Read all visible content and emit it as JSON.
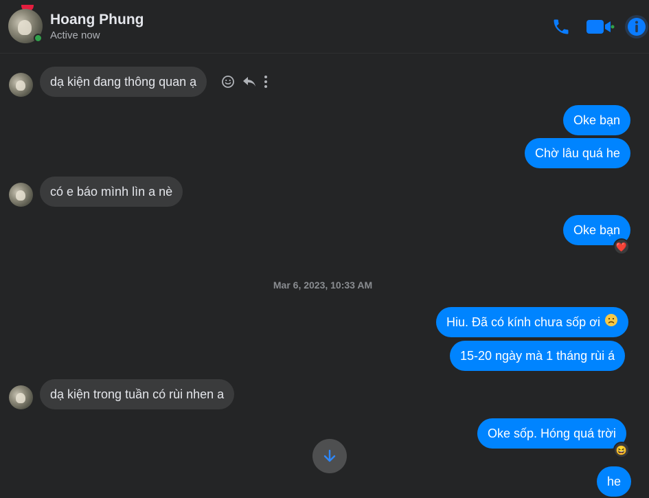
{
  "contact": {
    "name": "Hoang Phung",
    "status": "Active now"
  },
  "header_icons": [
    "call-icon",
    "video-icon",
    "info-icon"
  ],
  "colors": {
    "accent": "#0084ff",
    "icon_blue": "#0a7cff",
    "incoming_bubble": "#3a3b3c",
    "background": "#242526",
    "online": "#31a24c"
  },
  "messages": [
    {
      "direction": "in",
      "text": "dạ kiện đang thông quan ạ"
    },
    {
      "direction": "out",
      "text": "Oke bạn"
    },
    {
      "direction": "out",
      "text": "Chờ lâu quá he"
    },
    {
      "direction": "in",
      "text": "có e báo mình lìn a nè"
    },
    {
      "direction": "out",
      "text": "Oke bạn",
      "reaction": "❤️"
    },
    {
      "direction": "out",
      "text": "Hiu. Đã có kính chưa sốp ơi",
      "emoji": "☹"
    },
    {
      "direction": "out",
      "text": "15-20 ngày mà 1 tháng rùi á"
    },
    {
      "direction": "in",
      "text": "dạ kiện trong tuần có rùi nhen a"
    },
    {
      "direction": "out",
      "text": "Oke sốp. Hóng quá trời",
      "reaction": "😆"
    },
    {
      "direction": "out",
      "text": "he"
    }
  ],
  "timestamp": "Mar 6, 2023, 10:33 AM",
  "message_action_icons": [
    "react-icon",
    "reply-icon",
    "more-icon"
  ]
}
